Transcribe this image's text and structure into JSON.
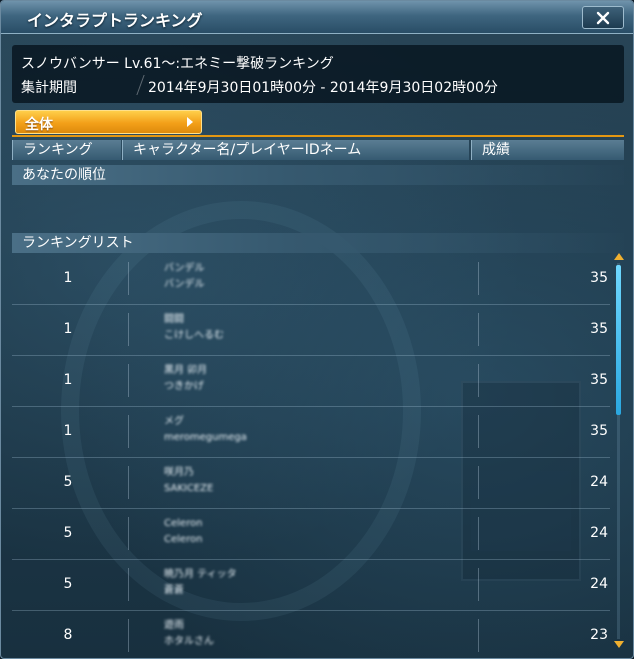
{
  "window": {
    "title": "インタラプトランキング",
    "close_icon": "close-icon"
  },
  "header": {
    "event_name": "スノウバンサー Lv.61〜:エネミー撃破ランキング",
    "period_label": "集計期間",
    "period_value": "2014年9月30日01時00分 - 2014年9月30日02時00分"
  },
  "filter": {
    "label": "全体"
  },
  "columns": {
    "rank": "ランキング",
    "name": "キャラクター名/プレイヤーIDネーム",
    "score": "成績"
  },
  "sections": {
    "my_rank": "あなたの順位",
    "list": "ランキングリスト"
  },
  "rows": [
    {
      "rank": "1",
      "score": "35",
      "line1": "バンデル",
      "line2": "バンデル"
    },
    {
      "rank": "1",
      "score": "35",
      "line1": "闘闘",
      "line2": "こけしへるむ"
    },
    {
      "rank": "1",
      "score": "35",
      "line1": "黒月 卯月",
      "line2": "つきかげ"
    },
    {
      "rank": "1",
      "score": "35",
      "line1": "メグ",
      "line2": "meromegumega"
    },
    {
      "rank": "5",
      "score": "24",
      "line1": "咲月乃",
      "line2": "SAKICEZE"
    },
    {
      "rank": "5",
      "score": "24",
      "line1": "Celeron",
      "line2": "Celeron"
    },
    {
      "rank": "5",
      "score": "24",
      "line1": "暁乃月 ティッタ",
      "line2": "蒼蒼"
    },
    {
      "rank": "8",
      "score": "23",
      "line1": "遊雨",
      "line2": "ホタルさん"
    }
  ],
  "colors": {
    "accent": "#f3a019",
    "scroll_thumb": "#3fc0f0",
    "title_bar": "#3f6680"
  }
}
